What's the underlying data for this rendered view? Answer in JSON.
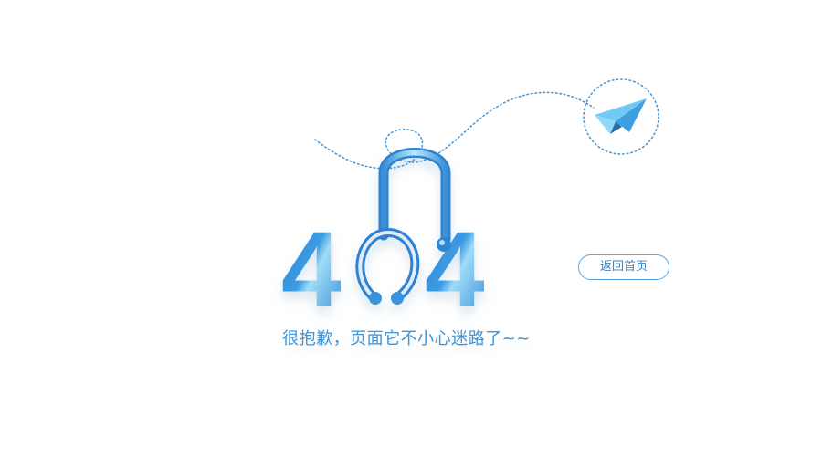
{
  "error": {
    "code_left": "4",
    "code_right": "4",
    "message": "很抱歉，页面它不小心迷路了~~"
  },
  "actions": {
    "home_label": "返回首页"
  },
  "icons": {
    "airplane": "paper-airplane-icon",
    "stethoscope": "stethoscope-icon"
  },
  "colors": {
    "primary": "#3d94d6",
    "dark_blue": "#2f7fcd",
    "light_blue": "#a9e4fb",
    "button_border": "#5aa5e0"
  }
}
